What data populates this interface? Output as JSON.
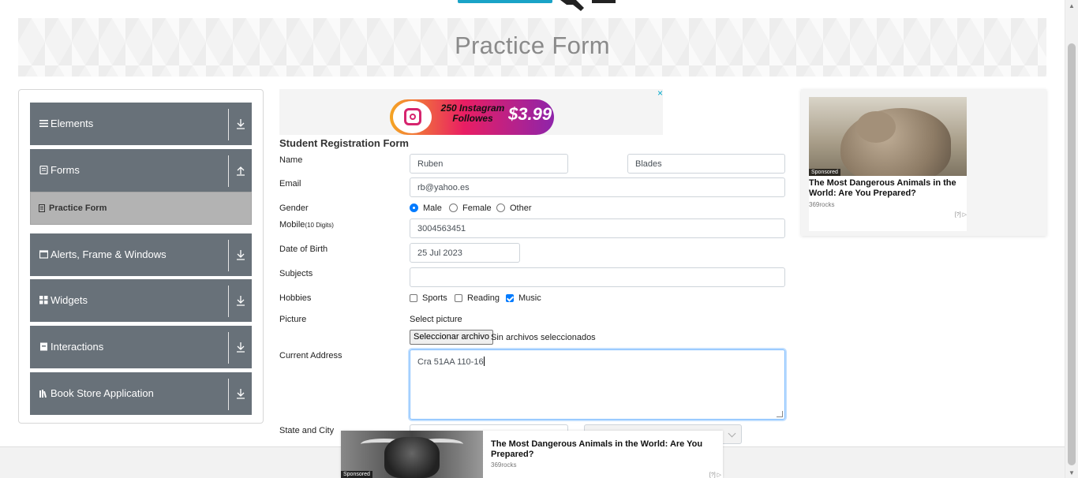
{
  "page": {
    "title": "Practice Form"
  },
  "sidebar": {
    "groups": [
      {
        "label": "Elements",
        "icon": "menu-icon"
      },
      {
        "label": "Forms",
        "icon": "form-icon"
      },
      {
        "label": "Alerts, Frame & Windows",
        "icon": "window-icon"
      },
      {
        "label": "Widgets",
        "icon": "grid-icon"
      },
      {
        "label": "Interactions",
        "icon": "interaction-icon"
      },
      {
        "label": "Book Store Application",
        "icon": "books-icon"
      }
    ],
    "active_item": "Practice Form"
  },
  "ads": {
    "top": {
      "line1": "250 Instagram",
      "line2": "Followes",
      "price": "$3.99",
      "close": "×"
    },
    "right": {
      "sponsored": "Sponsored",
      "title": "The Most Dangerous Animals in the World: Are You Prepared?",
      "source": "369rocks",
      "info": "[?] ▷"
    },
    "bottom": {
      "sponsored": "Sponsored",
      "title": "The Most Dangerous Animals in the World: Are You Prepared?",
      "source": "369rocks",
      "info": "[?] ▷"
    }
  },
  "form": {
    "title": "Student Registration Form",
    "labels": {
      "name": "Name",
      "email": "Email",
      "gender": "Gender",
      "mobile": "Mobile",
      "mobile_hint": "(10 Digits)",
      "dob": "Date of Birth",
      "subjects": "Subjects",
      "hobbies": "Hobbies",
      "picture": "Picture",
      "address": "Current Address",
      "state_city": "State and City"
    },
    "first_name": "Ruben",
    "last_name": "Blades",
    "email": "rb@yahoo.es",
    "gender_options": [
      {
        "label": "Male",
        "checked": true
      },
      {
        "label": "Female",
        "checked": false
      },
      {
        "label": "Other",
        "checked": false
      }
    ],
    "mobile": "3004563451",
    "dob": "25 Jul 2023",
    "subjects": "",
    "hobbies": [
      {
        "label": "Sports",
        "checked": false
      },
      {
        "label": "Reading",
        "checked": false
      },
      {
        "label": "Music",
        "checked": true
      }
    ],
    "select_picture": "Select picture",
    "file_button": "Seleccionar archivo",
    "file_status": "Sin archivos seleccionados",
    "address": "Cra 51AA 110-16"
  },
  "colors": {
    "sidebar_group_bg": "#687179",
    "active_item_bg": "#b3b3b3",
    "accent": "#007bff",
    "banner_title": "#8a8a8a"
  }
}
